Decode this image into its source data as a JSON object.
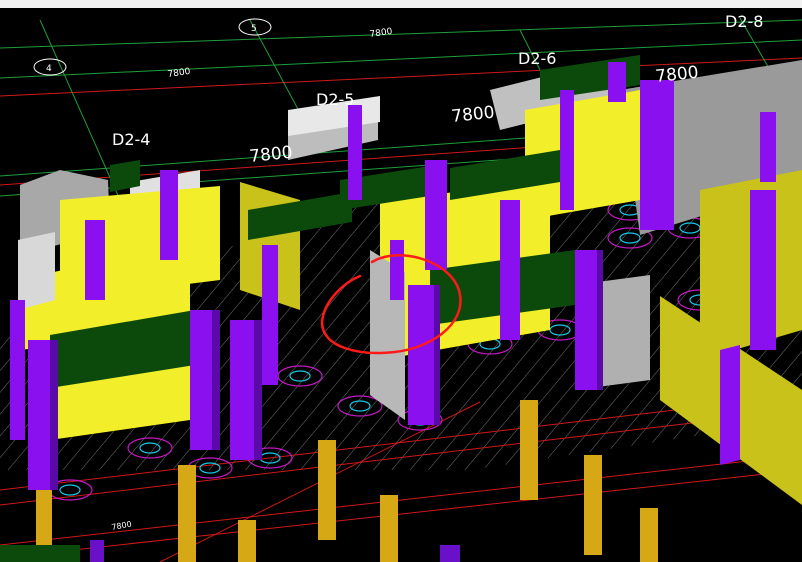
{
  "grid_labels": [
    "D2-4",
    "D2-5",
    "D2-6",
    "D2-8"
  ],
  "dimensions": [
    "7800",
    "7800",
    "7800",
    "7800",
    "7800",
    "7800"
  ],
  "bubble_labels": [
    "4",
    "5"
  ],
  "colors": {
    "background": "#000000",
    "wall_yellow": "#f2ee2a",
    "wall_yellow_dark": "#c8c21a",
    "column_purple": "#8a10f0",
    "column_purple_dark": "#5a0aa8",
    "beam_green": "#0c4a0c",
    "wall_gray": "#a8a8a8",
    "pile_gold": "#d6a816",
    "pile_purple": "#6a10c8",
    "grid_line_green": "#1e9e3a",
    "grid_line_red": "#d01818",
    "pile_circle_magenta": "#c21ac2",
    "pile_circle_cyan": "#18c8e8",
    "markup_red": "#ff1a1a"
  }
}
